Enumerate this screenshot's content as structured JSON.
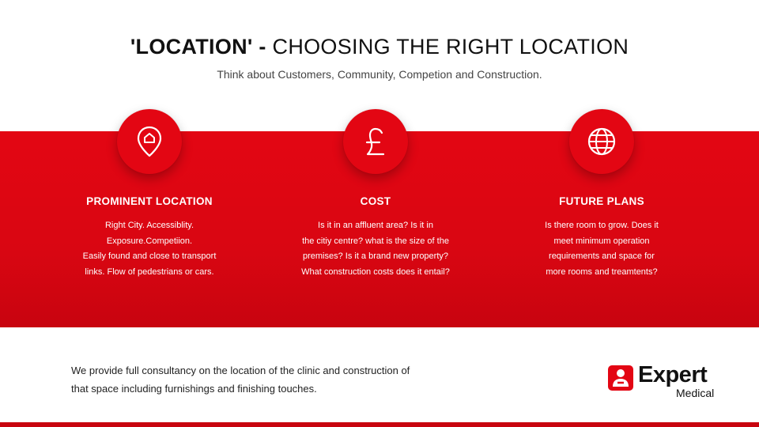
{
  "header": {
    "title_bold": "'LOCATION' -",
    "title_rest": " CHOOSING THE RIGHT LOCATION",
    "subtitle": "Think about Customers, Community, Competion and Construction."
  },
  "columns": [
    {
      "icon": "location-pin-home-icon",
      "title": "PROMINENT LOCATION",
      "lines": [
        "Right City. Accessiblity.",
        "Exposure.Competiion.",
        "Easily found and close to transport",
        "links. Flow of pedestrians or cars."
      ]
    },
    {
      "icon": "pound-sterling-icon",
      "title": "COST",
      "lines": [
        "Is it in an affluent area? Is it in",
        "the citiy centre? what is the size of the",
        "premises? Is it a brand new property?",
        "What construction costs does it entail?"
      ]
    },
    {
      "icon": "globe-icon",
      "title": "FUTURE PLANS",
      "lines": [
        "Is there room to grow. Does it",
        "meet minimum operation",
        "requirements and space for",
        "more rooms and treamtents?"
      ]
    }
  ],
  "footer": {
    "lines": [
      "We provide full consultancy on the location of the clinic and construction of",
      "that space including furnishings and finishing touches."
    ]
  },
  "logo": {
    "word1": "Expert",
    "word2": "Medical",
    "icon": "expert-medical-logo-icon"
  },
  "colors": {
    "brand_red": "#e30613",
    "text_dark": "#111111",
    "text_light": "#ffffff"
  }
}
